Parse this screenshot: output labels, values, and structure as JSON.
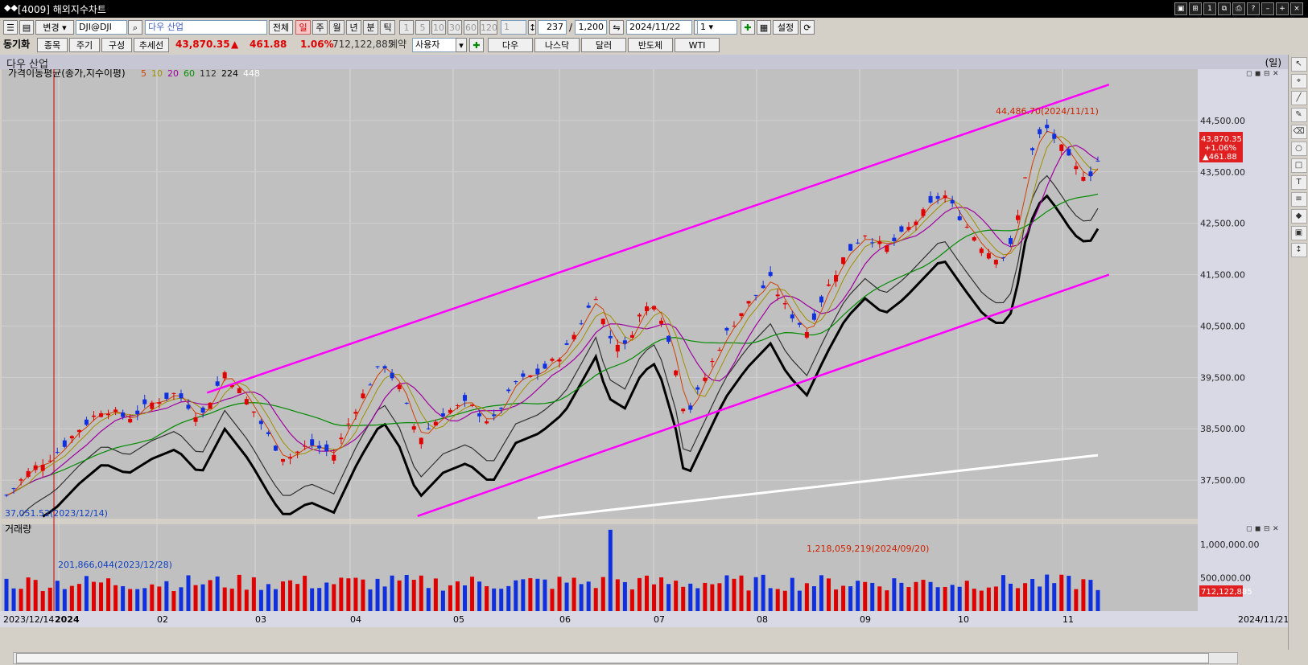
{
  "window": {
    "title": "[4009] 해외지수차트",
    "logo": "◆◆"
  },
  "toolbar": {
    "change_btn": "변경",
    "symbol_code": "DJI@DJI",
    "symbol_name": "다우 산업",
    "all_btn": "전체",
    "periods": [
      "일",
      "주",
      "월",
      "년",
      "분",
      "틱"
    ],
    "active_period": "일",
    "minutes": [
      "1",
      "5",
      "10",
      "30",
      "60",
      "120"
    ],
    "minute_value": "1",
    "count": "237",
    "count_max": "1,200",
    "date": "2024/11/22",
    "chart_count": "1",
    "settings": "설정"
  },
  "toolbar2": {
    "sync_label": "동기화",
    "item_btn": "종목",
    "cycle_btn": "주기",
    "config_btn": "구성",
    "trend_btn": "추세선",
    "price": "43,870.35",
    "arrow": "▲",
    "change": "461.88",
    "pct": "1.06%",
    "volume": "712,122,885",
    "volume_unit": "계약",
    "user_select": "사용자",
    "compare": [
      "다우",
      "나스닥",
      "달러",
      "반도체",
      "WTI"
    ]
  },
  "chart_header": {
    "name": "다우 산업",
    "unit": "(일)"
  },
  "indicator": {
    "label": "가격이동평균(종가,지수이평)",
    "periods": [
      "5",
      "10",
      "20",
      "60",
      "112",
      "224",
      "448"
    ],
    "colors": [
      "#d04000",
      "#a09000",
      "#a000a0",
      "#009000",
      "#303030",
      "#000000",
      "#ffffff"
    ]
  },
  "volume_label": "거래량",
  "annotations": {
    "high": "44,486.70(2024/11/11)",
    "low": "37,051.52(2023/12/14)",
    "vol_high": "1,218,059,219(2024/09/20)",
    "vol_low": "201,866,044(2023/12/28)"
  },
  "price_badge": {
    "price": "43,870.35",
    "pct": "+1.06%",
    "change": "▲461.88"
  },
  "vol_badge": "712,122,885",
  "colors": {
    "up": "#e00000",
    "down": "#1030e0",
    "channel": "#ff00ff",
    "bg": "#c0c0c0"
  },
  "chart_data": {
    "type": "candlestick",
    "y_ticks": [
      "44,500.00",
      "43,500.00",
      "42,500.00",
      "41,500.00",
      "40,500.00",
      "39,500.00",
      "38,500.00",
      "37,500.00"
    ],
    "ylim": [
      36750,
      45500
    ],
    "vol_ticks": [
      "1,000,000.00",
      "500,000.00"
    ],
    "x_labels": [
      "2023/12/14",
      "2024",
      "02",
      "03",
      "04",
      "05",
      "06",
      "07",
      "08",
      "09",
      "10",
      "11",
      "2024/11/21"
    ],
    "trendline_upper": [
      [
        "2024/02/28",
        39200
      ],
      [
        "2024/11/30",
        45200
      ]
    ],
    "trendline_lower": [
      [
        "2024/05/01",
        36800
      ],
      [
        "2024/11/30",
        41500
      ]
    ],
    "close_path": [
      [
        0,
        37200
      ],
      [
        10,
        37700
      ],
      [
        20,
        38000
      ],
      [
        30,
        38500
      ],
      [
        40,
        38900
      ],
      [
        50,
        38700
      ],
      [
        60,
        39000
      ],
      [
        70,
        39200
      ],
      [
        80,
        38700
      ],
      [
        90,
        39600
      ],
      [
        100,
        39000
      ],
      [
        110,
        38200
      ],
      [
        115,
        37900
      ],
      [
        125,
        38200
      ],
      [
        135,
        38000
      ],
      [
        145,
        39000
      ],
      [
        155,
        39800
      ],
      [
        162,
        39300
      ],
      [
        170,
        38300
      ],
      [
        180,
        38800
      ],
      [
        190,
        39000
      ],
      [
        200,
        38600
      ],
      [
        210,
        39400
      ],
      [
        220,
        39600
      ],
      [
        230,
        40000
      ],
      [
        236,
        40500
      ],
      [
        243,
        41100
      ],
      [
        248,
        40300
      ],
      [
        255,
        40100
      ],
      [
        262,
        40800
      ],
      [
        268,
        41000
      ],
      [
        276,
        39700
      ],
      [
        280,
        38700
      ],
      [
        288,
        39500
      ],
      [
        296,
        40300
      ],
      [
        305,
        40900
      ],
      [
        315,
        41400
      ],
      [
        322,
        40800
      ],
      [
        330,
        40400
      ],
      [
        338,
        41200
      ],
      [
        346,
        41900
      ],
      [
        354,
        42300
      ],
      [
        362,
        42000
      ],
      [
        370,
        42300
      ],
      [
        378,
        42700
      ],
      [
        386,
        43100
      ],
      [
        395,
        42500
      ],
      [
        403,
        42000
      ],
      [
        410,
        41800
      ],
      [
        415,
        42100
      ],
      [
        421,
        43700
      ],
      [
        428,
        44400
      ],
      [
        433,
        44100
      ],
      [
        440,
        43600
      ],
      [
        446,
        43400
      ],
      [
        452,
        43870
      ]
    ]
  }
}
